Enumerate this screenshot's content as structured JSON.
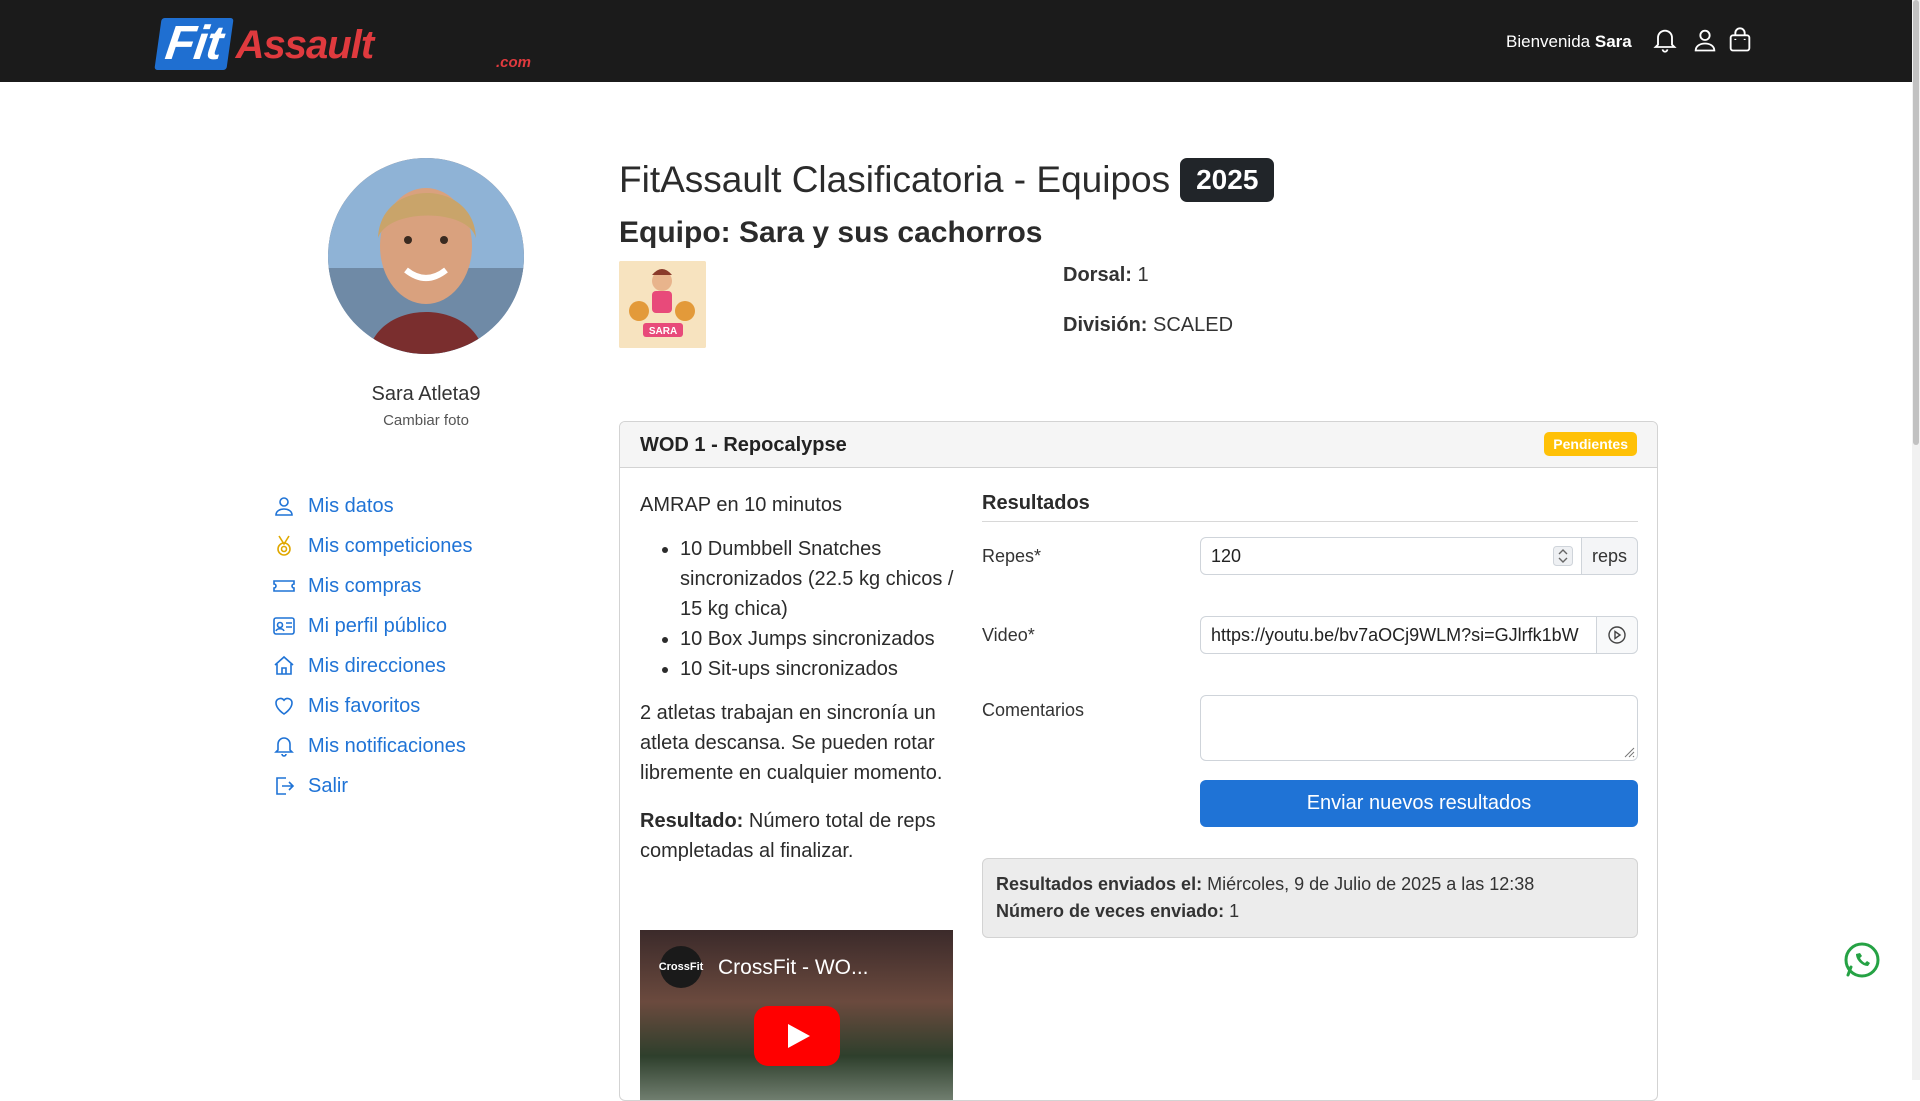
{
  "header": {
    "logo_fit": "Fit",
    "logo_assault": "Assault",
    "logo_com": ".com",
    "welcome_prefix": "Bienvenida",
    "welcome_name": "Sara",
    "icons": [
      "bell-icon",
      "user-icon",
      "bag-icon"
    ]
  },
  "profile": {
    "name": "Sara Atleta9",
    "change_photo": "Cambiar foto"
  },
  "menu": [
    {
      "label": "Mis datos",
      "icon": "user-icon"
    },
    {
      "label": "Mis competiciones",
      "icon": "medal-icon"
    },
    {
      "label": "Mis compras",
      "icon": "ticket-icon"
    },
    {
      "label": "Mi perfil público",
      "icon": "id-card-icon"
    },
    {
      "label": "Mis direcciones",
      "icon": "house-icon"
    },
    {
      "label": "Mis favoritos",
      "icon": "heart-icon"
    },
    {
      "label": "Mis notificaciones",
      "icon": "bell-icon"
    },
    {
      "label": "Salir",
      "icon": "logout-icon"
    }
  ],
  "competition": {
    "title": "FitAssault Clasificatoria - Equipos",
    "year": "2025",
    "team_title": "Equipo: Sara y sus cachorros",
    "team_logo_text": "SARA",
    "dorsal_label": "Dorsal:",
    "dorsal_value": "1",
    "division_label": "División:",
    "division_value": "SCALED"
  },
  "wod": {
    "title": "WOD 1 - Repocalypse",
    "status": "Pendientes",
    "intro": "AMRAP en 10 minutos",
    "movements": [
      "10 Dumbbell Snatches sincronizados (22.5 kg chicos / 15 kg chica)",
      "10 Box Jumps sincronizados",
      "10 Sit-ups sincronizados"
    ],
    "note": "2 atletas trabajan en sincronía un atleta descansa. Se pueden rotar libremente en cualquier momento.",
    "result_label": "Resultado:",
    "result_text": "Número total de reps completadas al finalizar.",
    "video": {
      "channel": "CrossFit",
      "title": "CrossFit - WO..."
    }
  },
  "results_form": {
    "title": "Resultados",
    "reps_label": "Repes*",
    "reps_value": "120",
    "reps_unit": "reps",
    "video_label": "Video*",
    "video_value": "https://youtu.be/bv7aOCj9WLM?si=GJlrfk1bW",
    "comments_label": "Comentarios",
    "comments_value": "",
    "submit_label": "Enviar nuevos resultados",
    "sent_label": "Resultados enviados el:",
    "sent_value": "Miércoles, 9 de Julio de 2025 a las 12:38",
    "count_label": "Número de veces enviado:",
    "count_value": "1"
  },
  "colors": {
    "accent": "#1f73d6",
    "header_bg": "#1b1b1b",
    "pending": "#ffc107"
  }
}
